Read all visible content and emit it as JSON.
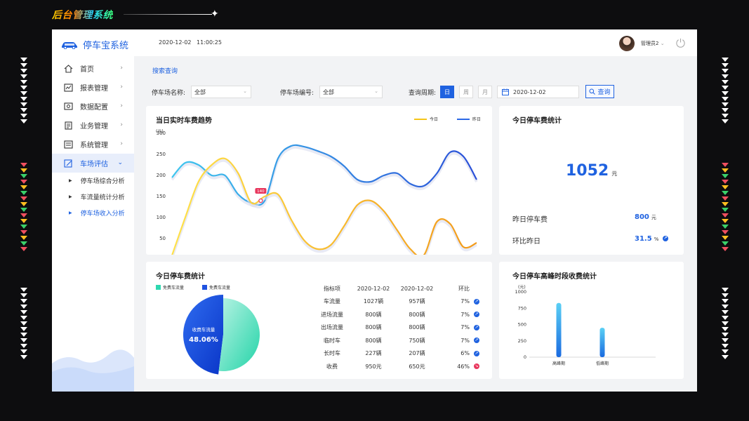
{
  "banner": {
    "title": "后台管理系统"
  },
  "app": {
    "name": "停车宝系统"
  },
  "sidebar": {
    "items": [
      {
        "label": "首页",
        "icon": "home-icon"
      },
      {
        "label": "报表管理",
        "icon": "report-icon"
      },
      {
        "label": "数据配置",
        "icon": "data-config-icon"
      },
      {
        "label": "业务管理",
        "icon": "business-icon"
      },
      {
        "label": "系统管理",
        "icon": "system-icon"
      },
      {
        "label": "车场评估",
        "icon": "evaluate-icon",
        "active": true
      }
    ],
    "subitems": [
      {
        "label": "停车场综合分析"
      },
      {
        "label": "车流量统计分析"
      },
      {
        "label": "停车场收入分析",
        "active": true
      }
    ]
  },
  "header": {
    "date": "2020-12-02",
    "time": "11:00:25",
    "user": "管理员2"
  },
  "search": {
    "title": "搜索查询",
    "lot_name_label": "停车场名称:",
    "lot_name_value": "全部",
    "lot_no_label": "停车场编号:",
    "lot_no_value": "全部",
    "period_label": "查询周期:",
    "periods": [
      "日",
      "周",
      "月"
    ],
    "active_period": "日",
    "date": "2020-12-02",
    "query_button": "查询"
  },
  "trend_card": {
    "title": "当日实时车费趋势",
    "tooltip_value": "140",
    "chart_data": {
      "type": "line",
      "title": "当日实时车费趋势",
      "ylabel": "(元)",
      "ylim": [
        0,
        300
      ],
      "yticks": [
        0,
        50,
        100,
        150,
        200,
        250,
        300
      ],
      "x_labels": [
        "0:00",
        "2:00",
        "4:00",
        "6:00",
        "8:00",
        "10:00",
        "12:00",
        "14:00",
        "16:00",
        "18:00",
        "20:00",
        "22:00",
        "23:00"
      ],
      "x_ticks_hours": [
        0,
        2,
        4,
        6,
        8,
        10,
        12,
        14,
        16,
        18,
        20,
        22,
        23
      ],
      "series": [
        {
          "name": "今日",
          "color": "#f5c518",
          "x": [
            0,
            1,
            2,
            3,
            4,
            5,
            6,
            7,
            8,
            9,
            10,
            11,
            12,
            13,
            14,
            15,
            16,
            17,
            18,
            19,
            20,
            21,
            22,
            23
          ],
          "y": [
            10,
            100,
            185,
            225,
            240,
            205,
            135,
            150,
            155,
            95,
            45,
            25,
            35,
            80,
            130,
            140,
            115,
            70,
            25,
            10,
            90,
            85,
            30,
            40
          ]
        },
        {
          "name": "昨日",
          "color": "#2b68e6",
          "x": [
            0,
            1,
            2,
            3,
            4,
            5,
            6,
            7,
            8,
            9,
            10,
            11,
            12,
            13,
            14,
            15,
            16,
            17,
            18,
            19,
            20,
            21,
            22,
            23
          ],
          "y": [
            195,
            230,
            225,
            200,
            200,
            155,
            135,
            140,
            240,
            270,
            268,
            258,
            245,
            222,
            190,
            185,
            200,
            205,
            180,
            175,
            205,
            255,
            245,
            190
          ]
        }
      ]
    }
  },
  "today_fee": {
    "title": "今日停车费统计",
    "value": "1052",
    "unit": "元",
    "yesterday_label": "昨日停车费",
    "yesterday_value": "800",
    "yesterday_unit": "元",
    "ratio_label": "环比昨日",
    "ratio_value": "31.5",
    "ratio_unit": "%"
  },
  "flow_card": {
    "title": "今日停车费统计",
    "legend": [
      "免费车流量",
      "免费车流量"
    ],
    "pie_label": "收费车流量",
    "pie_value": "48.06%",
    "chart_data": {
      "type": "pie",
      "slices": [
        {
          "name": "收费车流量",
          "value": 48.06,
          "color": "#1f52e0"
        },
        {
          "name": "免费车流量",
          "value": 51.94,
          "color": "#2ed8b0"
        }
      ]
    },
    "table": {
      "headers": [
        "指标项",
        "2020-12-02",
        "2020-12-02",
        "环比"
      ],
      "rows": [
        {
          "label": "车流量",
          "today": "1027辆",
          "yesterday": "957辆",
          "ratio": "7%",
          "trend": "up"
        },
        {
          "label": "进场流量",
          "today": "800辆",
          "yesterday": "800辆",
          "ratio": "7%",
          "trend": "up"
        },
        {
          "label": "出场流量",
          "today": "800辆",
          "yesterday": "800辆",
          "ratio": "7%",
          "trend": "up"
        },
        {
          "label": "临时车",
          "today": "800辆",
          "yesterday": "750辆",
          "ratio": "7%",
          "trend": "up"
        },
        {
          "label": "长时车",
          "today": "227辆",
          "yesterday": "207辆",
          "ratio": "6%",
          "trend": "up"
        },
        {
          "label": "收费",
          "today": "950元",
          "yesterday": "650元",
          "ratio": "46%",
          "trend": "down"
        }
      ]
    }
  },
  "peak_card": {
    "title": "今日停车高峰时段收费统计",
    "chart_data": {
      "type": "bar",
      "ylabel": "(元)",
      "ylim": [
        0,
        1000
      ],
      "yticks": [
        0,
        250,
        500,
        750,
        1000
      ],
      "categories": [
        "高峰期",
        "低峰期"
      ],
      "values": [
        830,
        450
      ]
    }
  }
}
